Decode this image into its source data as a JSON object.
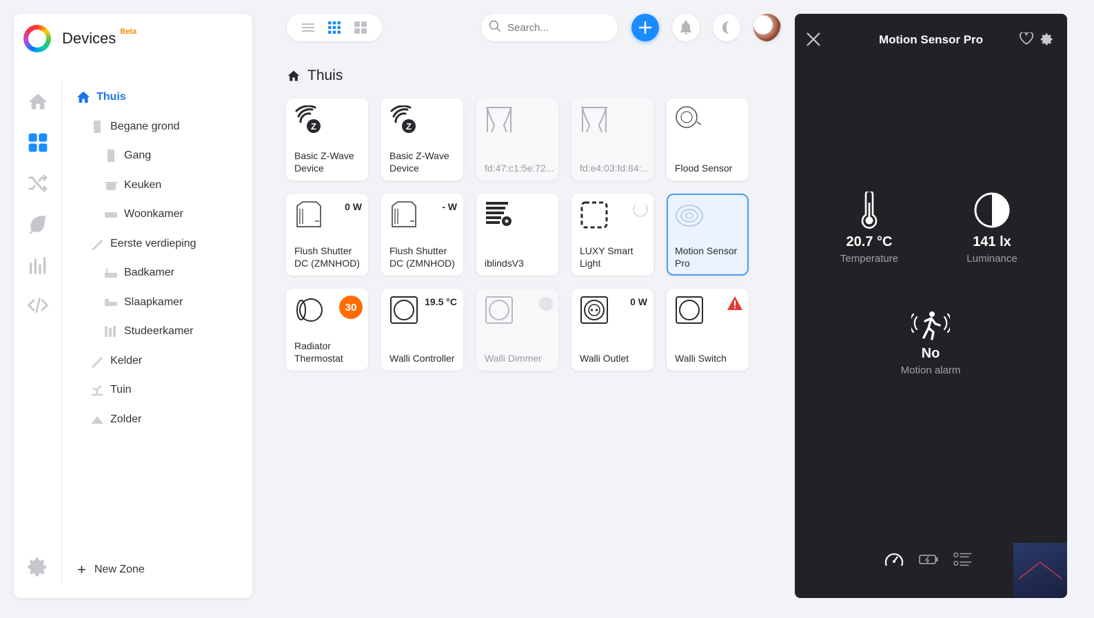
{
  "app": {
    "title": "Devices",
    "badge": "Beta"
  },
  "rail": {
    "items": [
      {
        "icon": "home-icon",
        "active": false
      },
      {
        "icon": "devices-grid-icon",
        "active": true
      },
      {
        "icon": "flows-icon",
        "active": false
      },
      {
        "icon": "energy-leaf-icon",
        "active": false
      },
      {
        "icon": "insights-icon",
        "active": false
      },
      {
        "icon": "code-icon",
        "active": false
      }
    ],
    "settings_icon": "gear-icon"
  },
  "zones": [
    {
      "label": "Thuis",
      "level": 0,
      "active": true
    },
    {
      "label": "Begane grond",
      "level": 1
    },
    {
      "label": "Gang",
      "level": 2
    },
    {
      "label": "Keuken",
      "level": 2
    },
    {
      "label": "Woonkamer",
      "level": 2
    },
    {
      "label": "Eerste verdieping",
      "level": 1
    },
    {
      "label": "Badkamer",
      "level": 2
    },
    {
      "label": "Slaapkamer",
      "level": 2
    },
    {
      "label": "Studeerkamer",
      "level": 2
    },
    {
      "label": "Kelder",
      "level": 1
    },
    {
      "label": "Tuin",
      "level": 1
    },
    {
      "label": "Zolder",
      "level": 1
    }
  ],
  "new_zone_label": "New Zone",
  "search": {
    "placeholder": "Search..."
  },
  "colors": {
    "accent": "#1a8cff",
    "active_zone": "#1a73e8",
    "badge_orange": "#ff6d00",
    "warning_red": "#e53935",
    "panel_dark": "#222226"
  },
  "heading": "Thuis",
  "devices": [
    {
      "name": "Basic Z-Wave\nDevice",
      "icon": "zwave-icon"
    },
    {
      "name": "Basic Z-Wave\nDevice",
      "icon": "zwave-icon"
    },
    {
      "name": "fd:47:c1:5e:72...",
      "icon": "curtain-icon",
      "off": true
    },
    {
      "name": "fd:e4:03:fd:84:...",
      "icon": "curtain-icon",
      "off": true
    },
    {
      "name": "Flood Sensor",
      "icon": "flood-sensor-icon"
    },
    {
      "name": "Flush Shutter\nDC (ZMNHOD)",
      "icon": "module-icon",
      "value": "0 W"
    },
    {
      "name": "Flush Shutter\nDC (ZMNHOD)",
      "icon": "module-icon",
      "value": "- W"
    },
    {
      "name": "iblindsV3",
      "icon": "blinds-gear-icon"
    },
    {
      "name": "LUXY Smart\nLight",
      "icon": "dashed-square-icon",
      "spinner": true
    },
    {
      "name": "Motion Sensor\nPro",
      "icon": "motion-sensor-icon",
      "selected": true
    },
    {
      "name": "Radiator\nThermostat",
      "icon": "thermostat-icon",
      "badge": "30"
    },
    {
      "name": "Walli Controller",
      "icon": "wall-switch-icon",
      "value": "19.5 °C"
    },
    {
      "name": "Walli Dimmer",
      "icon": "wall-switch-icon",
      "off": true,
      "dot": true
    },
    {
      "name": "Walli Outlet",
      "icon": "wall-outlet-icon",
      "value": "0 W"
    },
    {
      "name": "Walli Switch",
      "icon": "wall-switch-icon",
      "warning": true
    }
  ],
  "detail": {
    "title": "Motion Sensor Pro",
    "capabilities": [
      {
        "value": "20.7 °C",
        "label": "Temperature",
        "icon": "thermometer-icon"
      },
      {
        "value": "141 lx",
        "label": "Luminance",
        "icon": "luminance-icon"
      },
      {
        "value": "No",
        "label": "Motion alarm",
        "icon": "motion-alarm-icon"
      }
    ],
    "tabs": [
      "gauge-icon",
      "battery-icon",
      "list-icon"
    ]
  }
}
